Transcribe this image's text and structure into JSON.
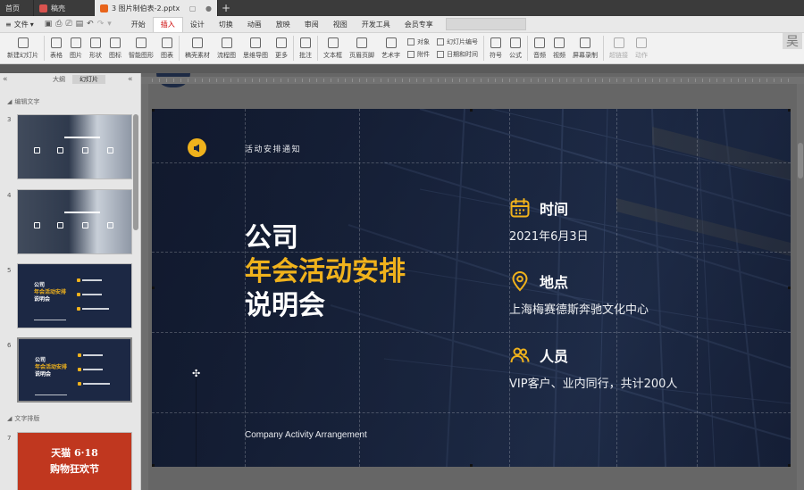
{
  "tabs": {
    "home": "首页",
    "pdf": "稿壳",
    "document": "3 图片制伯表-2.pptx"
  },
  "menu": {
    "file": "文件",
    "items": [
      "开始",
      "插入",
      "设计",
      "切换",
      "动画",
      "放映",
      "审阅",
      "视图",
      "开发工具",
      "会员专享"
    ],
    "active_index": 1
  },
  "ribbon": {
    "buttons": [
      {
        "label": "新建幻灯片",
        "icon": "new-slide-icon"
      },
      {
        "label": "表格",
        "icon": "table-icon"
      },
      {
        "label": "图片",
        "icon": "image-icon"
      },
      {
        "label": "形状",
        "icon": "shape-icon"
      },
      {
        "label": "图标",
        "icon": "icons-icon"
      },
      {
        "label": "智能图形",
        "icon": "smartart-icon"
      },
      {
        "label": "图表",
        "icon": "chart-icon"
      },
      {
        "label": "稿壳素材",
        "icon": "assets-icon"
      },
      {
        "label": "流程图",
        "icon": "flowchart-icon"
      },
      {
        "label": "思维导图",
        "icon": "mindmap-icon"
      },
      {
        "label": "更多",
        "icon": "more-icon"
      },
      {
        "label": "批注",
        "icon": "comment-icon"
      },
      {
        "label": "文本框",
        "icon": "textbox-icon"
      },
      {
        "label": "页眉页脚",
        "icon": "header-footer-icon"
      },
      {
        "label": "艺术字",
        "icon": "wordart-icon"
      }
    ],
    "stack": [
      {
        "label": "对象",
        "icon": "object-icon"
      },
      {
        "label": "附件",
        "icon": "attachment-icon"
      },
      {
        "label": "幻灯片编号",
        "icon": "slide-number-icon"
      },
      {
        "label": "日期和时间",
        "icon": "datetime-icon"
      }
    ],
    "buttons2": [
      {
        "label": "符号",
        "icon": "symbol-icon"
      },
      {
        "label": "公式",
        "icon": "formula-icon"
      },
      {
        "label": "音频",
        "icon": "audio-icon"
      },
      {
        "label": "视频",
        "icon": "video-icon"
      },
      {
        "label": "屏幕录制",
        "icon": "screen-record-icon"
      }
    ],
    "disabled": [
      {
        "label": "超链接",
        "icon": "hyperlink-icon"
      },
      {
        "label": "动作",
        "icon": "action-icon"
      }
    ],
    "user_initial": "吴"
  },
  "left_panel": {
    "tabs": [
      "大纲",
      "幻灯片"
    ],
    "active_tab": 1,
    "sections": [
      "编辑文字",
      "文字排版"
    ],
    "slides": [
      {
        "number": "3",
        "kind": "photo"
      },
      {
        "number": "4",
        "kind": "photo"
      },
      {
        "number": "5",
        "kind": "dark",
        "lines": [
          "公司",
          "年会活动安排",
          "说明会"
        ]
      },
      {
        "number": "6",
        "kind": "dark",
        "lines": [
          "公司",
          "年会活动安排",
          "说明会"
        ]
      },
      {
        "number": "7",
        "kind": "red",
        "lines": [
          "天猫 6·18",
          "购物狂欢节"
        ]
      }
    ]
  },
  "slide": {
    "notice": "活动安排通知",
    "title_line1": "公司",
    "title_line2": "年会活动安排",
    "title_line3": "说明会",
    "subtitle": "Company Activity Arrangement",
    "info": [
      {
        "title": "时间",
        "value": "2021年6月3日",
        "icon": "calendar-icon"
      },
      {
        "title": "地点",
        "value": "上海梅赛德斯奔驰文化中心",
        "icon": "location-pin-icon"
      },
      {
        "title": "人员",
        "value": "VIP客户、业内同行，共计200人",
        "icon": "people-icon"
      }
    ]
  },
  "colors": {
    "accent": "#f0b21c",
    "slide_bg": "#1b2640",
    "ribbon_bg": "#f2f2f2",
    "red_slide": "#c0371f"
  }
}
